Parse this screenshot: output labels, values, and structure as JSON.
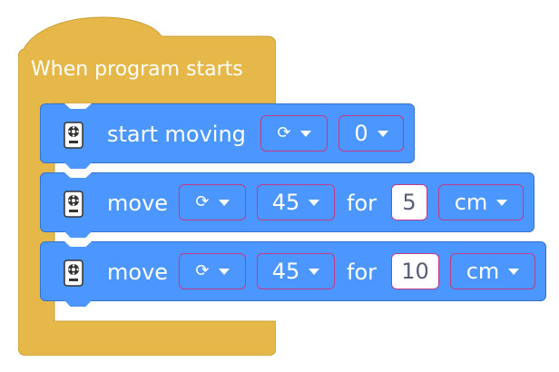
{
  "hat": {
    "label": "When program starts",
    "color": "#e6b84a"
  },
  "blocks": [
    {
      "label": "start moving",
      "direction_icon": "rotate-icon",
      "direction_value": "⟳",
      "speed": "0"
    },
    {
      "label": "move",
      "direction_icon": "rotate-icon",
      "direction_value": "⟳",
      "angle": "45",
      "for_label": "for",
      "distance": "5",
      "unit": "cm"
    },
    {
      "label": "move",
      "direction_icon": "rotate-icon",
      "direction_value": "⟳",
      "angle": "45",
      "for_label": "for",
      "distance": "10",
      "unit": "cm"
    }
  ],
  "colors": {
    "block": "#4c97ff",
    "block_border": "#3373cc",
    "field_border": "#c23a8a",
    "input_text": "#575e75"
  },
  "icons": {
    "robot_icon": "remote-control-icon",
    "caret": "chevron-down-icon"
  }
}
